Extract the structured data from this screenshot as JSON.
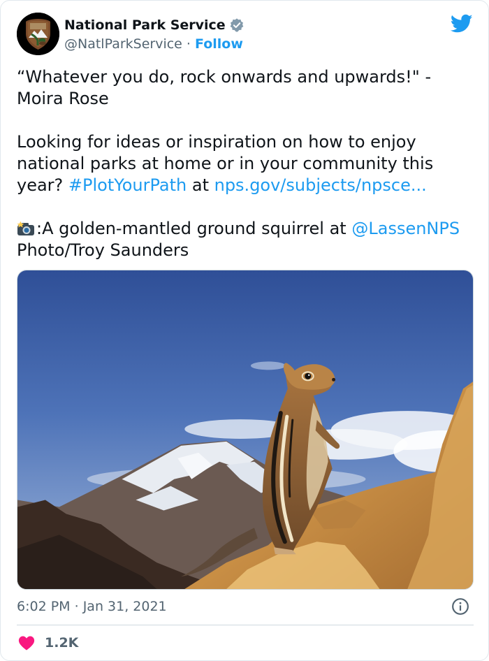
{
  "account": {
    "display_name": "National Park Service",
    "handle": "@NatlParkService",
    "separator": "·",
    "follow_label": "Follow"
  },
  "tweet": {
    "line1": "“Whatever you do, rock onwards and upwards!\" - Moira Rose",
    "line2_prefix": "Looking for ideas or inspiration on how to enjoy national parks at home or in your community this year? ",
    "hashtag": "#PlotYourPath",
    "line2_mid": " at ",
    "url": "nps.gov/subjects/npsce...",
    "line3_text": ":A golden-mantled ground squirrel at ",
    "mention": "@LassenNPS",
    "line3_suffix": " Photo/Troy Saunders"
  },
  "meta": {
    "time": "6:02 PM",
    "separator": "·",
    "date": "Jan 31, 2021"
  },
  "likes": {
    "count": "1.2K"
  },
  "icons": {
    "verified": "verified-badge-icon",
    "brand": "twitter-bird-icon",
    "camera": "camera-flash-emoji",
    "info": "info-icon",
    "like": "heart-icon"
  },
  "colors": {
    "link": "#1d9bf0",
    "heart": "#f91880",
    "muted": "#536471"
  }
}
